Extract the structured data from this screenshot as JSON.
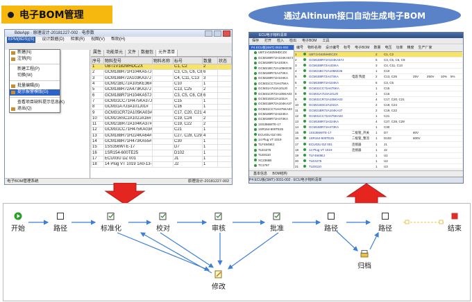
{
  "header": {
    "title": "电子BOM管理",
    "banner": "通过Altinum接口自动生成电子BOM"
  },
  "left_window": {
    "title": "BdeApp · 原理设计-20181227-002 · 电参数",
    "menu": [
      "EPM(BDS)(S)",
      "设计数据(D)",
      "检索(R)",
      "视图(V)",
      "帮助(H)"
    ],
    "dropdown": [
      "新建(N)",
      "注销(R)",
      "新建工程(P)",
      "切换(W)",
      "批量编辑(B)",
      "提示报警模版(G)",
      "查看项目缺料提示信息(K)",
      "退出(Q)"
    ],
    "dropdown_selected_index": 5,
    "tabs": [
      "属性",
      "功能单元",
      "文件",
      "数据包",
      "元件清单"
    ],
    "active_tab": "元件清单",
    "columns": [
      "序号",
      "物料型号",
      "物料名称",
      "标号",
      "数量",
      "状态"
    ],
    "rows": [
      [
        "1",
        "UBT1V182MHDCZX",
        "",
        "C1, C2",
        "2",
        ""
      ],
      [
        "2",
        "GCM188R71H104KA57J",
        "",
        "C3, C5, C6, C8",
        "6",
        ""
      ],
      [
        "3",
        "GCM188R72A103KA37J",
        "",
        "C4, C11, C13",
        "3",
        ""
      ],
      [
        "4",
        "GCM21BC72A105KE36#",
        "",
        "C10",
        "1",
        ""
      ],
      [
        "5",
        "GCM188R72A473KA37J",
        "",
        "C13, C25",
        "2",
        ""
      ],
      [
        "6",
        "GCM188R71H104KA57J",
        "",
        "C3, C5, C6, C8",
        "6",
        ""
      ],
      [
        "7",
        "GCM31CC71H475KA37J",
        "",
        "C15",
        "1",
        ""
      ],
      [
        "8",
        "GCM31A7U3A101J01#",
        "",
        "C16",
        "1",
        ""
      ],
      [
        "9",
        "GCM31CR72A105KA03#",
        "",
        "C17, C20, C21",
        "4",
        ""
      ],
      [
        "10",
        "GCM216SC2A102JA16#",
        "",
        "C19, C24",
        "2",
        ""
      ],
      [
        "11",
        "GCM21BR72A104KA37#",
        "",
        "C19, C22",
        "2",
        ""
      ],
      [
        "12",
        "GCM31CC71H475KA03#",
        "",
        "C21",
        "1",
        ""
      ],
      [
        "13",
        "GCM188R71H224KA64#",
        "",
        "C27, C28, C29",
        "4",
        ""
      ],
      [
        "14",
        "GCM188R71H473KA55#",
        "",
        "C30",
        "1",
        ""
      ],
      [
        "15",
        "1SS356WTE-17",
        "",
        "D7",
        "1",
        ""
      ],
      [
        "16",
        "1SR154-600TE25",
        "",
        "D102",
        "1",
        ""
      ],
      [
        "17",
        "ECU03U DZ 001",
        "",
        "J1",
        "1",
        ""
      ],
      [
        "18",
        "14 Plug VT 1019 1A0-13-1A",
        "",
        "J2",
        "1",
        ""
      ]
    ],
    "status_left": "电子BOM管理系统",
    "status_right": "原理设计-20181227-002"
  },
  "right_window": {
    "title": "ECU电子物料清单",
    "toolbar": [
      "保存",
      "打开",
      "检入",
      "检出",
      "电子BOM",
      "工具"
    ],
    "grid_tabs": [
      "编号",
      "物料名称",
      "设计编号",
      "标号",
      "电子BOM",
      "数量",
      "电压",
      "功率",
      "精度",
      "生产厂家"
    ],
    "tree_root": "P4 ECU板(SMT) 0031-002",
    "tree_items": [
      "UBT1V182MHDCZX",
      "GCM188R71H104KA57J",
      "GCM188R72A103KA",
      "GCM21BC72A105KE36",
      "GCM188R72A473KA",
      "GCM188R71H104KA",
      "GCM31CC71H475KA",
      "GCM31A7U3A101J0",
      "GCM31CR72A105KA03",
      "GCM216SC2A102JA",
      "GCM21BR72A104KA37",
      "GCM31CC71H475KA03",
      "GCM188R71H224KA",
      "GCM188R71H473KA",
      "1SS356WTE-17",
      "1SR154-600TE25",
      "ECU03U DZ 001",
      "14 Plug VT 1019",
      "TLF4949EJ",
      "TLE4275",
      "TLE8110",
      "XC2365B",
      "TC1767",
      "T2T1A80"
    ],
    "grid_rows": [
      [
        "1",
        "",
        "UBT1V182MHDCZX",
        "",
        "2",
        "C1, C2",
        "",
        "",
        "",
        ""
      ],
      [
        "2",
        "",
        "GCM188R71H104KA57J",
        "",
        "6",
        "C3, C5, C6, C8",
        "",
        "",
        "",
        ""
      ],
      [
        "3",
        "",
        "GCM188R72A103KA",
        "",
        "3",
        "C4, C11, C13",
        "",
        "",
        "",
        ""
      ],
      [
        "4",
        "",
        "GCM21BC72A105KE36",
        "",
        "1",
        "C10",
        "",
        "",
        "",
        ""
      ],
      [
        "5",
        "",
        "GCM188R72A473KA",
        "电容 陶瓷",
        "2",
        "C13, C25",
        "25V",
        "250V",
        "10%",
        "5%"
      ],
      [
        "6",
        "",
        "GCM188R71H104KA",
        "",
        "6",
        "C3, C5",
        "",
        "",
        "",
        ""
      ],
      [
        "7",
        "",
        "GCM31CC71H475KA",
        "",
        "1",
        "C15",
        "",
        "",
        "",
        ""
      ],
      [
        "8",
        "",
        "GCM31A7U3A101J0",
        "",
        "1",
        "C16",
        "",
        "",
        "",
        ""
      ],
      [
        "9",
        "",
        "GCM31CR72A105KA03",
        "",
        "4",
        "C17, C20, C21",
        "",
        "",
        "",
        ""
      ],
      [
        "10",
        "",
        "GCM216SC2A102JA",
        "",
        "2",
        "C19, C24",
        "",
        "",
        "",
        ""
      ],
      [
        "11",
        "",
        "GCM21BR72A104KA37",
        "",
        "2",
        "C19, C22",
        "",
        "",
        "",
        ""
      ],
      [
        "12",
        "",
        "GCM31CC71H475KA03",
        "",
        "1",
        "C21",
        "",
        "",
        "",
        ""
      ],
      [
        "13",
        "",
        "GCM188R71H224KA",
        "",
        "4",
        "C27, C28, C29",
        "",
        "",
        "",
        ""
      ],
      [
        "14",
        "",
        "GCM188R71H473KA",
        "",
        "1",
        "C30",
        "",
        "",
        "",
        ""
      ],
      [
        "15",
        "",
        "1SS356WTE-17",
        "二极管_开关",
        "1",
        "D7",
        "80V",
        "",
        "",
        ""
      ],
      [
        "16",
        "",
        "1SR154-600TE25",
        "二极管_整流",
        "1",
        "D102",
        "600V",
        "",
        "",
        ""
      ],
      [
        "17",
        "",
        "ECU03U DZ 001",
        "连接器",
        "1",
        "J1",
        "",
        "",
        "",
        ""
      ],
      [
        "18",
        "",
        "14 Plug VT 1019",
        "连接器",
        "1",
        "J2",
        "",
        "",
        "",
        ""
      ],
      [
        "19",
        "",
        "TLF4949EJ",
        "",
        "1",
        "U1",
        "",
        "",
        "",
        ""
      ],
      [
        "20",
        "",
        "TLE4275",
        "",
        "1",
        "U2",
        "",
        "",
        "",
        ""
      ],
      [
        "21",
        "",
        "TLE8110",
        "",
        "1",
        "U3",
        "",
        "",
        "",
        ""
      ],
      [
        "22",
        "",
        "XC2365B",
        "",
        "1",
        "U4",
        "",
        "",
        "",
        ""
      ]
    ],
    "bottom_tabs": [
      "基本信息",
      "BOM结构"
    ],
    "taskbar": "P4 ECU板(SMT) 0031-002 · ECU电子物料清单"
  },
  "workflow": {
    "nodes": {
      "start": "开始",
      "route1": "路径",
      "standardize": "标准化",
      "proofread": "校对",
      "review": "审核",
      "approve": "批准",
      "route2": "路径",
      "route3": "路径",
      "archive": "归档",
      "modify": "修改",
      "end": "结束"
    },
    "colors": {
      "start": "#2a9d2a",
      "end": "#d9302c",
      "arrow": "#3b7fd6",
      "big_arrow": "#e52520",
      "banner": "#5a82c8",
      "title_bg": "#f6b80e"
    }
  }
}
